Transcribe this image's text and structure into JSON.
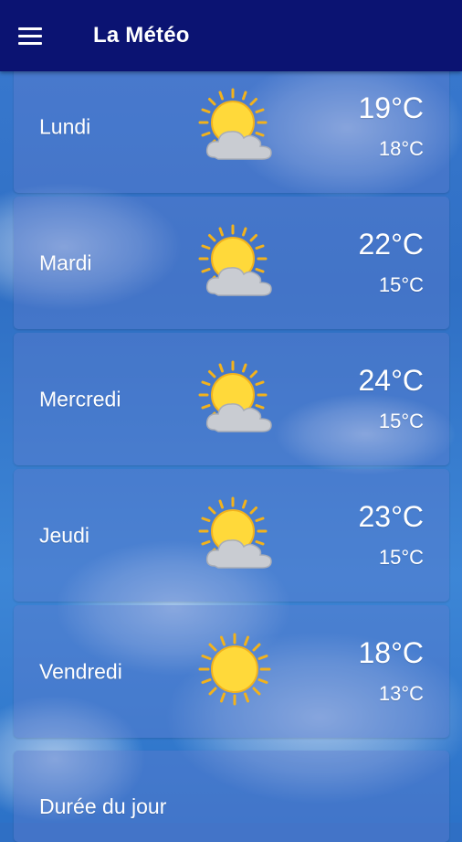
{
  "app_bar": {
    "title": "La Météo",
    "menu_icon": "hamburger-menu-icon",
    "background": "#0b1372"
  },
  "forecast": [
    {
      "day": "Lundi",
      "high": "19°C",
      "low": "18°C",
      "icon": "sun-behind-cloud-icon"
    },
    {
      "day": "Mardi",
      "high": "22°C",
      "low": "15°C",
      "icon": "sun-behind-cloud-icon"
    },
    {
      "day": "Mercredi",
      "high": "24°C",
      "low": "15°C",
      "icon": "sun-behind-cloud-icon"
    },
    {
      "day": "Jeudi",
      "high": "23°C",
      "low": "15°C",
      "icon": "sun-behind-cloud-icon"
    },
    {
      "day": "Vendredi",
      "high": "18°C",
      "low": "13°C",
      "icon": "sun-icon"
    }
  ],
  "daylight_card": {
    "label": "Durée du jour"
  },
  "colors": {
    "sun": "#ffd93a",
    "sun_rays": "#f2b21c",
    "cloud": "#c9ccd2"
  }
}
